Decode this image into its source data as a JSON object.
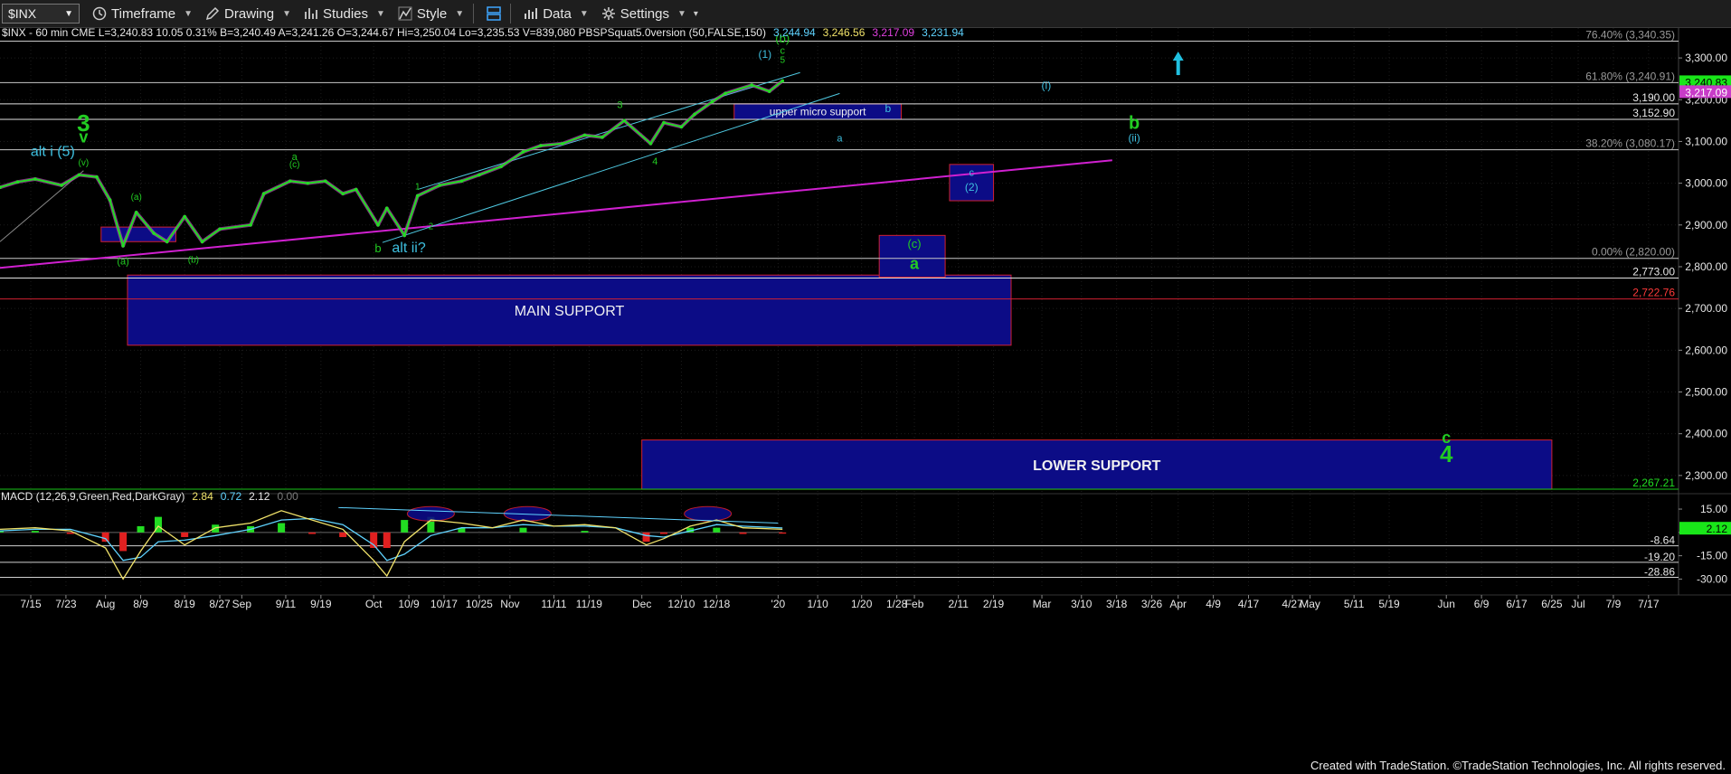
{
  "toolbar": {
    "symbol": "$INX",
    "timeframe": "Timeframe",
    "drawing": "Drawing",
    "studies": "Studies",
    "style": "Style",
    "data": "Data",
    "settings": "Settings"
  },
  "chart_data": {
    "type": "line",
    "header": [
      {
        "text": "$INX - 60 min  CME  L=3,240.83  10.05  0.31%  B=3,240.49  A=3,241.26  O=3,244.67  Hi=3,250.04  Lo=3,235.53  V=839,080  PBSPSquat5.0version (50,FALSE,150)",
        "color": "#e8e8e8"
      },
      {
        "text": "3,244.94",
        "color": "#5fd3ff"
      },
      {
        "text": "3,246.56",
        "color": "#f1e36a"
      },
      {
        "text": "3,217.09",
        "color": "#e040e0"
      },
      {
        "text": "3,231.94",
        "color": "#5fd3ff"
      }
    ],
    "y_ticks": [
      "3,300.00",
      "3,200.00",
      "3,100.00",
      "3,000.00",
      "2,900.00",
      "2,800.00",
      "2,700.00",
      "2,600.00",
      "2,500.00",
      "2,400.00",
      "2,300.00"
    ],
    "y_tick_values": [
      3300,
      3200,
      3100,
      3000,
      2900,
      2800,
      2700,
      2600,
      2500,
      2400,
      2300
    ],
    "ylim": [
      2267.21,
      3350
    ],
    "x_ticks": [
      "7/15",
      "7/23",
      "Aug",
      "8/9",
      "8/19",
      "8/27",
      "Sep",
      "9/11",
      "9/19",
      "Oct",
      "10/9",
      "10/17",
      "10/25",
      "Nov",
      "11/11",
      "11/19",
      "Dec",
      "12/10",
      "12/18",
      "'20",
      "1/10",
      "1/20",
      "1/28",
      "Feb",
      "2/11",
      "2/19",
      "Mar",
      "3/10",
      "3/18",
      "3/26",
      "Apr",
      "4/9",
      "4/17",
      "4/27",
      "May",
      "5/11",
      "5/19",
      "Jun",
      "6/9",
      "6/17",
      "6/25",
      "Jul",
      "7/9",
      "7/17"
    ],
    "x_dates": [
      "2019-07-15",
      "2019-07-23",
      "2019-08-01",
      "2019-08-09",
      "2019-08-19",
      "2019-08-27",
      "2019-09-01",
      "2019-09-11",
      "2019-09-19",
      "2019-10-01",
      "2019-10-09",
      "2019-10-17",
      "2019-10-25",
      "2019-11-01",
      "2019-11-11",
      "2019-11-19",
      "2019-12-01",
      "2019-12-10",
      "2019-12-18",
      "2020-01-01",
      "2020-01-10",
      "2020-01-20",
      "2020-01-28",
      "2020-02-01",
      "2020-02-11",
      "2020-02-19",
      "2020-03-01",
      "2020-03-10",
      "2020-03-18",
      "2020-03-26",
      "2020-04-01",
      "2020-04-09",
      "2020-04-17",
      "2020-04-27",
      "2020-05-01",
      "2020-05-11",
      "2020-05-19",
      "2020-06-01",
      "2020-06-09",
      "2020-06-17",
      "2020-06-25",
      "2020-07-01",
      "2020-07-09",
      "2020-07-17"
    ],
    "price_series": {
      "dates": [
        "2019-07-08",
        "2019-07-12",
        "2019-07-16",
        "2019-07-22",
        "2019-07-26",
        "2019-07-30",
        "2019-08-02",
        "2019-08-05",
        "2019-08-08",
        "2019-08-12",
        "2019-08-15",
        "2019-08-19",
        "2019-08-23",
        "2019-08-27",
        "2019-09-03",
        "2019-09-06",
        "2019-09-12",
        "2019-09-16",
        "2019-09-20",
        "2019-09-24",
        "2019-09-27",
        "2019-10-02",
        "2019-10-04",
        "2019-10-08",
        "2019-10-11",
        "2019-10-16",
        "2019-10-21",
        "2019-10-25",
        "2019-10-30",
        "2019-11-04",
        "2019-11-08",
        "2019-11-13",
        "2019-11-18",
        "2019-11-22",
        "2019-11-27",
        "2019-12-03",
        "2019-12-06",
        "2019-12-10",
        "2019-12-13",
        "2019-12-17",
        "2019-12-20",
        "2019-12-26",
        "2019-12-30",
        "2020-01-02"
      ],
      "values": [
        2990,
        3003,
        3010,
        2995,
        3020,
        3015,
        2960,
        2850,
        2930,
        2880,
        2860,
        2920,
        2860,
        2890,
        2900,
        2975,
        3005,
        3000,
        3005,
        2975,
        2985,
        2900,
        2940,
        2875,
        2970,
        2995,
        3005,
        3020,
        3040,
        3075,
        3090,
        3095,
        3115,
        3110,
        3150,
        3095,
        3145,
        3135,
        3165,
        3195,
        3215,
        3235,
        3220,
        3245
      ]
    },
    "h_levels": [
      {
        "price": 3340.35,
        "label": "76.40% (3,340.35)",
        "style": "fib"
      },
      {
        "price": 3240.91,
        "label": "61.80% (3,240.91)",
        "style": "fib"
      },
      {
        "price": 3190.0,
        "label": "3,190.00",
        "style": "support"
      },
      {
        "price": 3152.9,
        "label": "3,152.90",
        "style": "support"
      },
      {
        "price": 3080.17,
        "label": "38.20% (3,080.17)",
        "style": "fib"
      },
      {
        "price": 2820.0,
        "label": "0.00% (2,820.00)",
        "style": "fib"
      },
      {
        "price": 2773.0,
        "label": "2,773.00",
        "style": "support"
      },
      {
        "price": 2722.76,
        "label": "2,722.76",
        "style": "red"
      },
      {
        "price": 2267.21,
        "label": "2,267.21",
        "style": "green"
      }
    ],
    "price_markers": [
      {
        "price": 3240.83,
        "label": "3,240.83",
        "bg": "#19e619",
        "fg": "#000"
      },
      {
        "price": 3217.09,
        "label": "3,217.09",
        "bg": "#c83cc8",
        "fg": "#fff"
      }
    ],
    "zones": [
      {
        "label": "MAIN SUPPORT",
        "d1": "2019-08-06",
        "d2": "2020-02-23",
        "p1": 2780,
        "p2": 2612
      },
      {
        "label": "LOWER SUPPORT",
        "d1": "2019-12-01",
        "d2": "2020-06-25",
        "p1": 2385,
        "p2": 2267
      },
      {
        "label": "upper micro support",
        "d1": "2019-12-22",
        "d2": "2020-01-29",
        "p1": 3190,
        "p2": 3152.9
      },
      {
        "label": "",
        "d1": "2020-01-24",
        "d2": "2020-02-08",
        "p1": 2875,
        "p2": 2775
      },
      {
        "label": "",
        "d1": "2020-02-09",
        "d2": "2020-02-19",
        "p1": 3045,
        "p2": 2958
      },
      {
        "label": "",
        "d1": "2019-07-31",
        "d2": "2019-08-17",
        "p1": 2895,
        "p2": 2860
      }
    ],
    "trendline_magenta": {
      "d1": "2019-07-01",
      "p1": 2790,
      "d2": "2020-03-17",
      "p2": 3055
    },
    "channel_lines": [
      {
        "d1": "2019-10-11",
        "p1": 2985,
        "d2": "2020-01-06",
        "p2": 3265
      },
      {
        "d1": "2019-10-03",
        "p1": 2858,
        "d2": "2020-01-15",
        "p2": 3215
      }
    ],
    "wave_labels": [
      {
        "text": "3",
        "date": "2019-07-27",
        "price": 3125,
        "color": "#22cc22",
        "size": 26
      },
      {
        "text": "v",
        "date": "2019-07-27",
        "price": 3098,
        "color": "#22cc22",
        "size": 18
      },
      {
        "text": "alt i (5)",
        "date": "2019-07-20",
        "price": 3065,
        "color": "#3ec0e0",
        "size": 16
      },
      {
        "text": "(v)",
        "date": "2019-07-27",
        "price": 3043,
        "color": "#22cc22",
        "size": 10
      },
      {
        "text": "(a)",
        "date": "2019-08-08",
        "price": 2960,
        "color": "#22cc22",
        "size": 10
      },
      {
        "text": "(a)",
        "date": "2019-08-05",
        "price": 2805,
        "color": "#22cc22",
        "size": 11
      },
      {
        "text": "(b)",
        "date": "2019-08-21",
        "price": 2810,
        "color": "#22cc22",
        "size": 10
      },
      {
        "text": "a",
        "date": "2019-09-13",
        "price": 3055,
        "color": "#22cc22",
        "size": 11
      },
      {
        "text": "(c)",
        "date": "2019-09-13",
        "price": 3038,
        "color": "#22cc22",
        "size": 10
      },
      {
        "text": "b",
        "date": "2019-10-02",
        "price": 2835,
        "color": "#22cc22",
        "size": 13
      },
      {
        "text": "alt ii?",
        "date": "2019-10-09",
        "price": 2835,
        "color": "#3ec0e0",
        "size": 16
      },
      {
        "text": "1",
        "date": "2019-10-11",
        "price": 2985,
        "color": "#22cc22",
        "size": 10
      },
      {
        "text": "2",
        "date": "2019-10-14",
        "price": 2890,
        "color": "#22cc22",
        "size": 10
      },
      {
        "text": "3",
        "date": "2019-11-26",
        "price": 3180,
        "color": "#22cc22",
        "size": 11
      },
      {
        "text": "4",
        "date": "2019-12-04",
        "price": 3045,
        "color": "#22cc22",
        "size": 11
      },
      {
        "text": "(1)",
        "date": "2019-12-29",
        "price": 3300,
        "color": "#3ec0e0",
        "size": 12
      },
      {
        "text": "(b)",
        "date": "2020-01-02",
        "price": 3337,
        "color": "#22cc22",
        "size": 13
      },
      {
        "text": "c",
        "date": "2020-01-02",
        "price": 3310,
        "color": "#22cc22",
        "size": 11
      },
      {
        "text": "5",
        "date": "2020-01-02",
        "price": 3288,
        "color": "#22cc22",
        "size": 10
      },
      {
        "text": "(i)",
        "date": "2020-03-02",
        "price": 3225,
        "color": "#3ec0e0",
        "size": 12
      },
      {
        "text": "b",
        "date": "2020-01-26",
        "price": 3170,
        "color": "#3ec0e0",
        "size": 12
      },
      {
        "text": "a",
        "date": "2020-01-15",
        "price": 3100,
        "color": "#3ec0e0",
        "size": 11
      },
      {
        "text": "b",
        "date": "2020-03-22",
        "price": 3130,
        "color": "#22cc22",
        "size": 20
      },
      {
        "text": "(ii)",
        "date": "2020-03-22",
        "price": 3100,
        "color": "#3ec0e0",
        "size": 12
      },
      {
        "text": "c",
        "date": "2020-02-14",
        "price": 3018,
        "color": "#3ec0e0",
        "size": 11
      },
      {
        "text": "(2)",
        "date": "2020-02-14",
        "price": 2982,
        "color": "#3ec0e0",
        "size": 12
      },
      {
        "text": "(c)",
        "date": "2020-02-01",
        "price": 2845,
        "color": "#22cc22",
        "size": 13
      },
      {
        "text": "a",
        "date": "2020-02-01",
        "price": 2795,
        "color": "#22cc22",
        "size": 18
      },
      {
        "text": "c",
        "date": "2020-06-01",
        "price": 2378,
        "color": "#22cc22",
        "size": 18
      },
      {
        "text": "4",
        "date": "2020-06-01",
        "price": 2332,
        "color": "#22cc22",
        "size": 26
      }
    ],
    "arrow": {
      "date": "2020-04-01",
      "price": 3285
    },
    "macd": {
      "header": [
        {
          "text": "MACD (12,26,9,Green,Red,DarkGray)",
          "color": "#e8e8e8"
        },
        {
          "text": "2.84",
          "color": "#f1e36a"
        },
        {
          "text": "0.72",
          "color": "#5fd3ff"
        },
        {
          "text": "2.12",
          "color": "#e8e8e8"
        },
        {
          "text": "0.00",
          "color": "#7a7a7a"
        }
      ],
      "y_ticks": [
        "15.00",
        "0.00",
        "-15.00",
        "-30.00"
      ],
      "y_tick_values": [
        15,
        0,
        -15,
        -30
      ],
      "ylim": [
        -35,
        22
      ],
      "levels": [
        {
          "value": -8.64,
          "label": "-8.64"
        },
        {
          "value": -19.2,
          "label": "-19.20"
        },
        {
          "value": -28.86,
          "label": "-28.86"
        }
      ],
      "current": {
        "value": 2.12,
        "label": "2.12"
      },
      "dates": [
        "2019-07-08",
        "2019-07-16",
        "2019-07-24",
        "2019-08-01",
        "2019-08-05",
        "2019-08-09",
        "2019-08-13",
        "2019-08-19",
        "2019-08-26",
        "2019-09-03",
        "2019-09-10",
        "2019-09-17",
        "2019-09-24",
        "2019-10-01",
        "2019-10-04",
        "2019-10-08",
        "2019-10-14",
        "2019-10-21",
        "2019-10-28",
        "2019-11-04",
        "2019-11-11",
        "2019-11-18",
        "2019-11-25",
        "2019-12-02",
        "2019-12-06",
        "2019-12-12",
        "2019-12-18",
        "2019-12-24",
        "2020-01-02"
      ],
      "macd": [
        2,
        3,
        1,
        -10,
        -30,
        -12,
        4,
        -8,
        3,
        6,
        14,
        8,
        2,
        -18,
        -28,
        -6,
        8,
        6,
        3,
        8,
        4,
        5,
        3,
        -8,
        -4,
        4,
        8,
        3,
        2
      ],
      "signal": [
        1,
        2,
        2,
        -4,
        -18,
        -16,
        -6,
        -5,
        -2,
        2,
        8,
        9,
        5,
        -8,
        -18,
        -14,
        -2,
        3,
        3,
        5,
        4,
        4,
        3,
        -2,
        -3,
        1,
        5,
        4,
        2.84
      ],
      "histogram": [
        1,
        1,
        -1,
        -6,
        -12,
        4,
        10,
        -3,
        5,
        4,
        6,
        -1,
        -3,
        -10,
        -10,
        8,
        10,
        3,
        0,
        3,
        0,
        1,
        0,
        -6,
        -1,
        3,
        3,
        -1,
        -0.8
      ],
      "circled_dates": [
        "2019-10-14",
        "2019-11-05",
        "2019-12-16"
      ],
      "trendline": {
        "d1": "2019-09-23",
        "v1": 16,
        "d2": "2020-01-01",
        "v2": 6
      }
    }
  },
  "footer": "Created with TradeStation. ©TradeStation Technologies, Inc. All rights reserved."
}
